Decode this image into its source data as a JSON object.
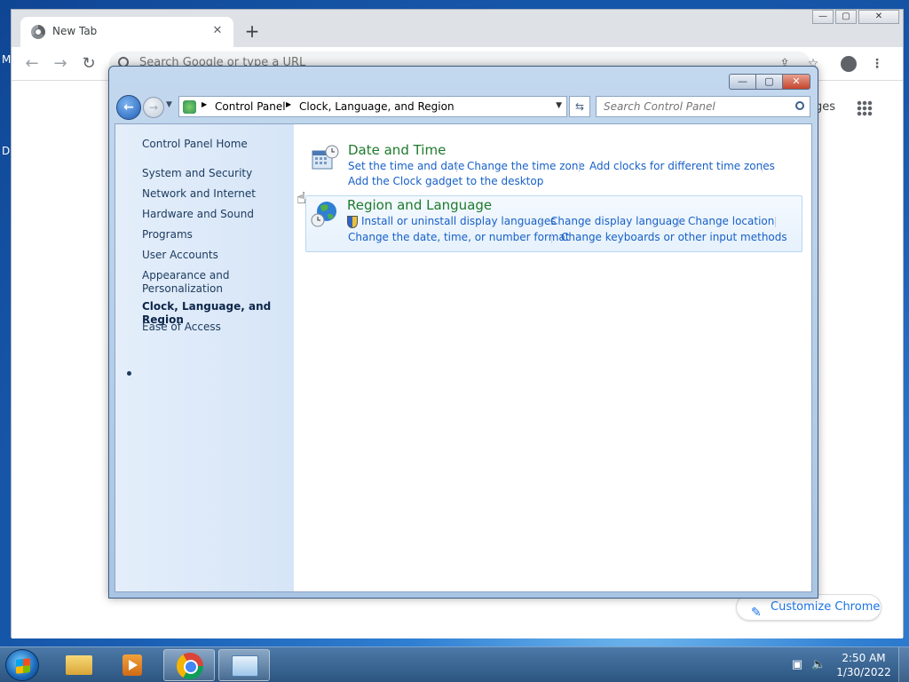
{
  "desktop": {
    "edge_letter_1": "M",
    "edge_letter_2": "D"
  },
  "chrome": {
    "tab_title": "New Tab",
    "tab_close": "✕",
    "new_tab": "+",
    "omnibox_placeholder": "Search Google or type a URL",
    "ntp_link_partial": "ges",
    "customize_label": "Customize Chrome",
    "win_buttons": {
      "minimize": "—",
      "maximize": "▢",
      "close": "✕"
    }
  },
  "control_panel": {
    "breadcrumbs": [
      "Control Panel",
      "Clock, Language, and Region"
    ],
    "search_placeholder": "Search Control Panel",
    "win_buttons": {
      "minimize": "—",
      "maximize": "▢",
      "close": "✕"
    },
    "sidebar": {
      "home": "Control Panel Home",
      "items": [
        "System and Security",
        "Network and Internet",
        "Hardware and Sound",
        "Programs",
        "User Accounts",
        "Appearance and Personalization",
        "Clock, Language, and Region",
        "Ease of Access"
      ],
      "active_index": 6
    },
    "categories": [
      {
        "title": "Date and Time",
        "links": [
          "Set the time and date",
          "Change the time zone",
          "Add clocks for different time zones",
          "Add the Clock gadget to the desktop"
        ]
      },
      {
        "title": "Region and Language",
        "links": [
          "Install or uninstall display languages",
          "Change display language",
          "Change location",
          "Change the date, time, or number format",
          "Change keyboards or other input methods"
        ]
      }
    ]
  },
  "taskbar": {
    "clock_time": "2:50 AM",
    "clock_date": "1/30/2022",
    "apps": [
      "windows-explorer",
      "media-player",
      "google-chrome",
      "control-panel"
    ]
  },
  "colors": {
    "category_title": "#1e7a2c",
    "link": "#1760c8",
    "sidebar_text": "#1b3a5e",
    "taskbar": "#2c5580"
  }
}
